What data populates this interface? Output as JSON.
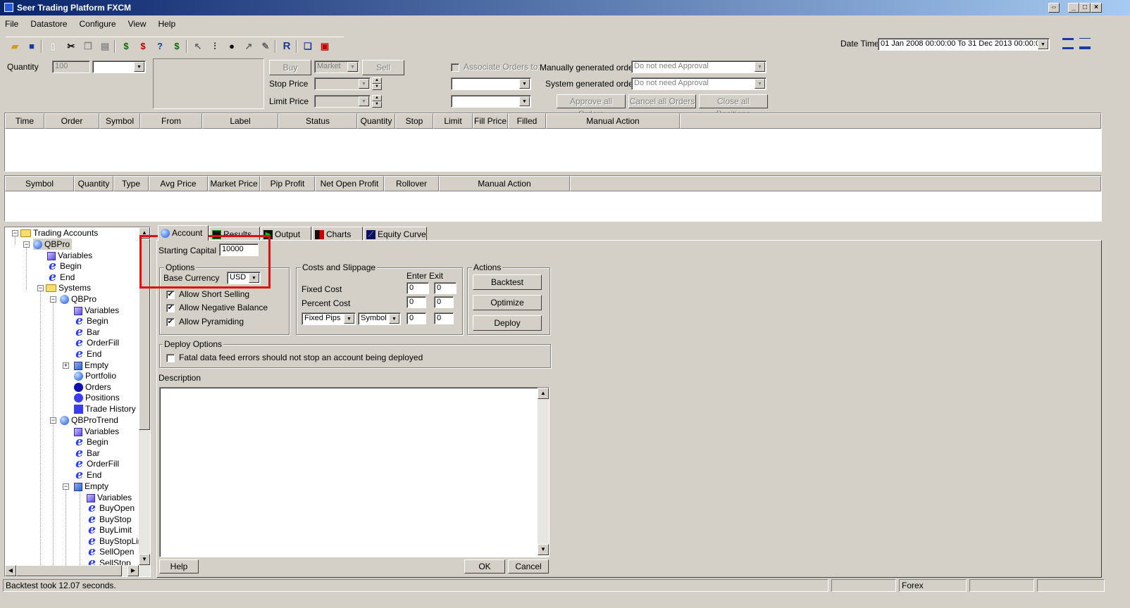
{
  "window": {
    "title": "Seer Trading Platform FXCM",
    "btn_restore": "⇔",
    "btn_min": "_",
    "btn_max": "□",
    "btn_close": "×"
  },
  "menu": [
    "File",
    "Datastore",
    "Configure",
    "View",
    "Help"
  ],
  "toolbar_date": {
    "label": "Date Time",
    "value": "01 Jan 2008 00:00:00 To 31 Dec 2013 00:00:00"
  },
  "order_entry": {
    "quantity_label": "Quantity",
    "quantity_value": "100",
    "buy": "Buy",
    "order_type": "Market",
    "sell": "Sell",
    "stop_price_label": "Stop Price",
    "limit_price_label": "Limit Price",
    "associate_label": "Associate Orders to:",
    "manual_label": "Manually generated orders",
    "manual_value": "Do not need Approval",
    "system_label": "System generated orders",
    "system_value": "Do not need Approval",
    "approve_all": "Approve all Orders",
    "cancel_all": "Cancel all Orders",
    "close_all": "Close all Positions"
  },
  "orders_columns": [
    "Time",
    "Order",
    "Symbol",
    "From",
    "Label",
    "Status",
    "Quantity",
    "Stop",
    "Limit",
    "Fill Price",
    "Filled",
    "Manual Action"
  ],
  "positions_columns": [
    "Symbol",
    "Quantity",
    "Type",
    "Avg Price",
    "Market Price",
    "Pip Profit",
    "Net Open Profit",
    "Rollover",
    "Manual Action"
  ],
  "tree": [
    "Trading Accounts",
    "QBPro",
    "Variables",
    "Begin",
    "End",
    "Systems",
    "QBPro",
    "Variables",
    "Begin",
    "Bar",
    "OrderFill",
    "End",
    "Empty",
    "Portfolio",
    "Orders",
    "Positions",
    "Trade History",
    "QBProTrend",
    "Variables",
    "Begin",
    "Bar",
    "OrderFill",
    "End",
    "Empty",
    "Variables",
    "BuyOpen",
    "BuyStop",
    "BuyLimit",
    "BuyStopLimit",
    "SellOpen",
    "SellStop"
  ],
  "tabs": [
    "Account",
    "Results",
    "Output",
    "Charts",
    "Equity Curve"
  ],
  "account": {
    "starting_capital_label": "Starting Capital",
    "starting_capital": "10000",
    "options_title": "Options",
    "base_currency_label": "Base Currency",
    "base_currency": "USD",
    "allow_short": "Allow Short Selling",
    "allow_negative": "Allow Negative Balance",
    "allow_pyramiding": "Allow Pyramiding",
    "costs_title": "Costs and Slippage",
    "enter_exit": "Enter Exit",
    "fixed_cost": "Fixed Cost",
    "percent_cost": "Percent Cost",
    "fixed_pips": "Fixed Pips",
    "symbol": "Symbol",
    "zero": "0",
    "actions_title": "Actions",
    "backtest": "Backtest",
    "optimize": "Optimize",
    "deploy": "Deploy",
    "deploy_options_title": "Deploy Options",
    "fatal_errors": "Fatal data feed errors should not stop an account being deployed",
    "description_label": "Description",
    "help": "Help",
    "ok": "OK",
    "cancel": "Cancel"
  },
  "checkmark": "✔",
  "status": {
    "message": "Backtest took 12.07 seconds.",
    "market": "Forex"
  }
}
